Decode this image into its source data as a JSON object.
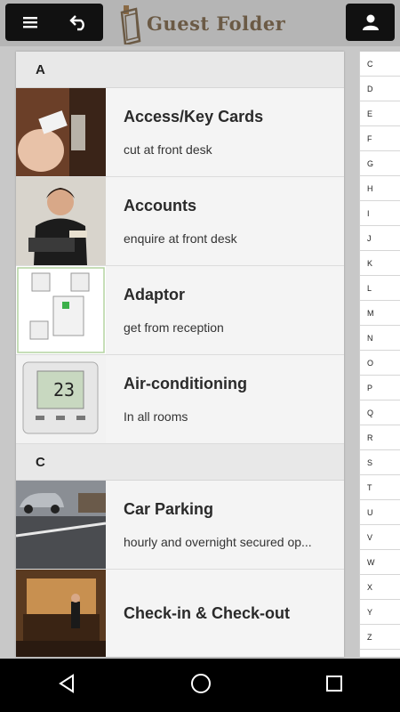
{
  "header": {
    "app_title": "Guest Folder",
    "menu_icon": "hamburger-menu-icon",
    "back_icon": "back-arrow-icon",
    "user_icon": "user-icon"
  },
  "sections": [
    {
      "letter": "A",
      "items": [
        {
          "title": "Access/Key Cards",
          "subtitle": "cut at front desk"
        },
        {
          "title": "Accounts",
          "subtitle": "enquire at front desk"
        },
        {
          "title": "Adaptor",
          "subtitle": "get from reception"
        },
        {
          "title": "Air-conditioning",
          "subtitle": "In all rooms"
        }
      ]
    },
    {
      "letter": "C",
      "items": [
        {
          "title": "Car Parking",
          "subtitle": "hourly and overnight secured op..."
        },
        {
          "title": "Check-in & Check-out",
          "subtitle": ""
        }
      ]
    }
  ],
  "thermostat_reading": "23",
  "alphabet_index": [
    "C",
    "D",
    "E",
    "F",
    "G",
    "H",
    "I",
    "J",
    "K",
    "L",
    "M",
    "N",
    "O",
    "P",
    "Q",
    "R",
    "S",
    "T",
    "U",
    "V",
    "W",
    "X",
    "Y",
    "Z"
  ],
  "system_nav": {
    "back": "nav-back-icon",
    "home": "nav-home-icon",
    "recents": "nav-recents-icon"
  }
}
